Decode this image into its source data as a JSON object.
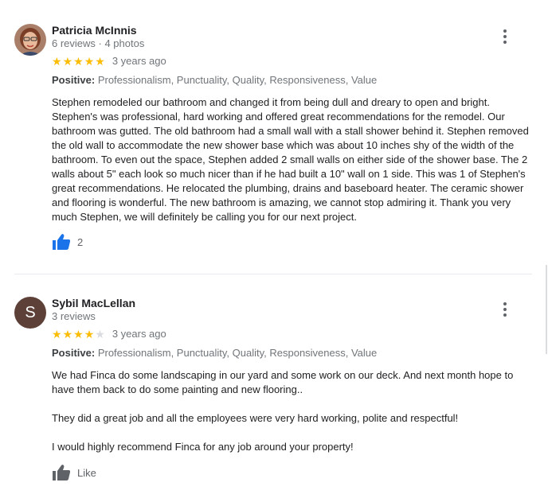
{
  "reviews": [
    {
      "name": "Patricia McInnis",
      "meta": "6 reviews · 4 photos",
      "rating": 5,
      "ago": "3 years ago",
      "positive_label": "Positive:",
      "positive_values": "Professionalism, Punctuality, Quality, Responsiveness, Value",
      "text": "Stephen remodeled our bathroom and changed it from being dull and dreary to open and bright. Stephen's was professional, hard working and offered great recommendations for the remodel.  Our bathroom was gutted.  The old bathroom had a small wall with a stall shower behind it.  Stephen removed the old wall to accommodate the new shower base which was about 10 inches shy of the width of the bathroom.  To even out the space, Stephen added 2 small walls on either side of the shower base. The 2 walls about 5\" each look so much nicer than if he had built a 10\"  wall on 1 side.  This was 1 of Stephen's great recommendations.  He relocated the plumbing, drains and baseboard heater.  The ceramic shower and flooring is wonderful.  The new bathroom is amazing, we cannot stop admiring it.  Thank you very much Stephen, we will definitely be calling you for our next project.",
      "like_label": "2"
    },
    {
      "name": "Sybil MacLellan",
      "avatar_letter": "S",
      "meta": "3 reviews",
      "rating": 4,
      "ago": "3 years ago",
      "positive_label": "Positive:",
      "positive_values": "Professionalism, Punctuality, Quality, Responsiveness, Value",
      "text_paragraphs": [
        "We had Finca do some landscaping in our yard and some work on our deck. And next month hope to have them back to do some painting and new flooring..",
        "They did a great job and all the employees were very hard working, polite and respectful!",
        "I would highly recommend Finca for any job around your property!"
      ],
      "like_label": "Like"
    }
  ],
  "colors": {
    "star_on": "#fbbc04",
    "star_off": "#dadce0",
    "like_active": "#1a73e8",
    "like_inactive": "#5f6368",
    "avatar_letter_bg": "#5d4037"
  },
  "icons": {
    "more": "more-vert-icon",
    "like": "thumbs-up-icon"
  }
}
